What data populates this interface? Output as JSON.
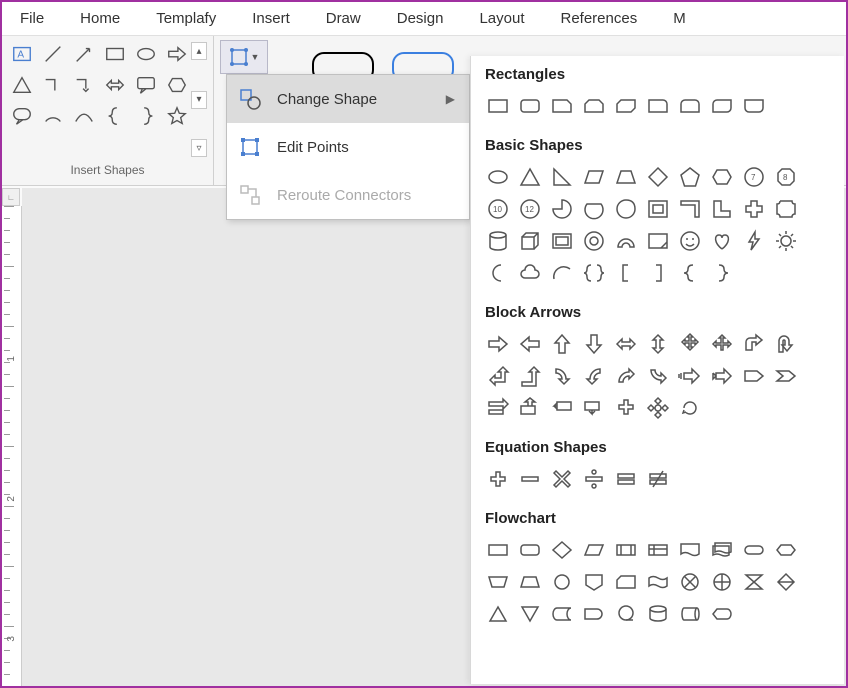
{
  "menubar": [
    "File",
    "Home",
    "Templafy",
    "Insert",
    "Draw",
    "Design",
    "Layout",
    "References",
    "M"
  ],
  "panel_label": "Insert Shapes",
  "context_menu": {
    "change_shape": "Change Shape",
    "edit_points": "Edit Points",
    "reroute": "Reroute Connectors"
  },
  "categories": {
    "rectangles": "Rectangles",
    "basic": "Basic Shapes",
    "arrows": "Block Arrows",
    "equation": "Equation Shapes",
    "flowchart": "Flowchart"
  },
  "ruler": {
    "marks": [
      "1",
      "2",
      "3"
    ]
  },
  "insert_shapes_grid": [
    [
      "text-box",
      "line",
      "arrow-line",
      "rect",
      "oval",
      "arrow-right"
    ],
    [
      "triangle",
      "elbow",
      "elbow-arrow",
      "double-arrow",
      "callout",
      "hexagon"
    ],
    [
      "speech",
      "arc",
      "curve",
      "brace-left",
      "brace-right",
      "star"
    ]
  ],
  "shape_list": {
    "rectangles": [
      "rect",
      "round-rect",
      "snip1",
      "snip2",
      "snipdiag",
      "round1",
      "round2",
      "rounddiag",
      "roundsame"
    ],
    "basic": [
      "oval",
      "triangle",
      "rtriangle",
      "parallelogram",
      "trapezoid",
      "diamond",
      "pentagon",
      "hexagon",
      "heptagon",
      "octagon",
      "decagon",
      "dodecagon",
      "pie",
      "chord",
      "teardrop",
      "frame",
      "halfframe",
      "lshape",
      "cross",
      "plaque",
      "can",
      "cube",
      "bevel",
      "donut",
      "block-arc",
      "folded",
      "smiley",
      "heart",
      "lightning",
      "sun",
      "moon",
      "cloud",
      "arc2",
      "braces",
      "lbracket",
      "rbracket",
      "lbrace",
      "rbrace"
    ],
    "arrows": [
      "right",
      "left",
      "up",
      "down",
      "leftright",
      "updown",
      "quad",
      "3way",
      "bent",
      "uturn",
      "leftup",
      "bentup",
      "curvedright",
      "curvedleft",
      "curvedup",
      "curveddown",
      "striped",
      "notched",
      "home",
      "chevron",
      "rcallout",
      "dcallout",
      "lcallout",
      "ucallout",
      "cross-arrow",
      "quad-callout",
      "circ-arrow"
    ],
    "equation": [
      "plus",
      "minus",
      "multiply",
      "divide",
      "equal",
      "notequal"
    ],
    "flowchart": [
      "process",
      "altprocess",
      "decision",
      "data",
      "predef",
      "internal",
      "document",
      "multidoc",
      "terminator",
      "prep",
      "manual",
      "manualop",
      "connector",
      "offpage",
      "card",
      "tape",
      "sumjunc",
      "or",
      "collate",
      "sort",
      "extract",
      "merge",
      "stored",
      "delay",
      "seqstore",
      "magnetic",
      "directaccess",
      "display"
    ]
  }
}
